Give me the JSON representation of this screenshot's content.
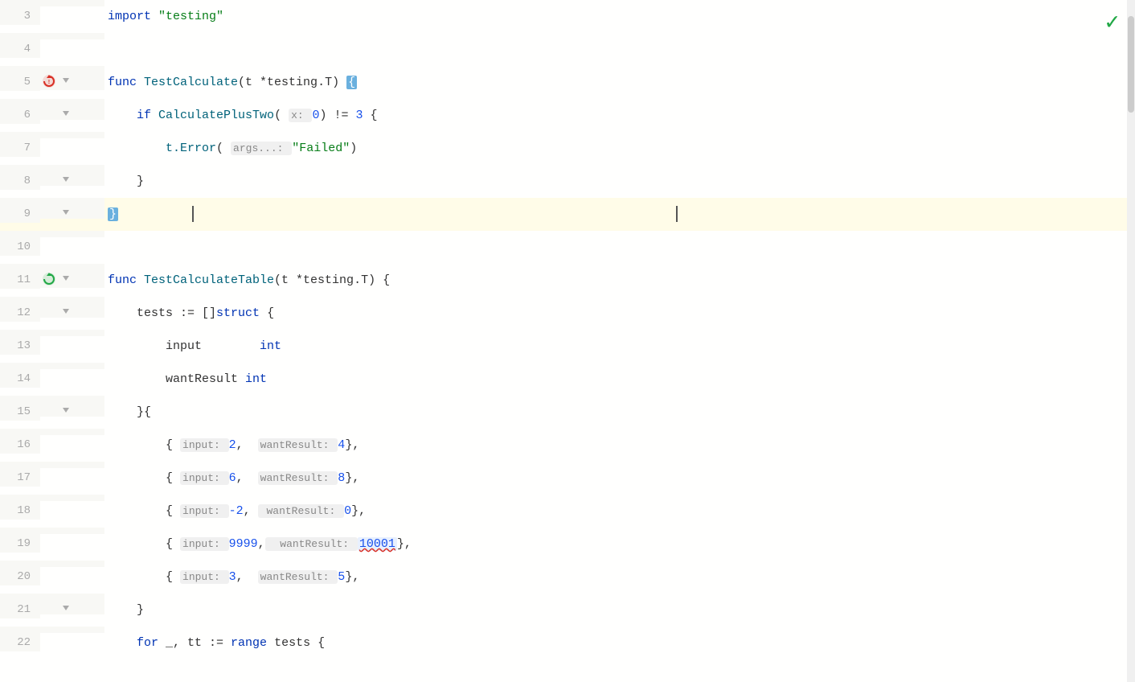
{
  "editor": {
    "background": "#fffffe",
    "checkmark": "✓",
    "lines": [
      {
        "number": "3",
        "indent": 0,
        "tokens": [
          {
            "text": "import ",
            "class": "kw"
          },
          {
            "text": "\"testing\"",
            "class": "str"
          }
        ],
        "fold": null,
        "run": null,
        "highlighted": false
      },
      {
        "number": "4",
        "indent": 0,
        "tokens": [],
        "fold": null,
        "run": null,
        "highlighted": false
      },
      {
        "number": "5",
        "indent": 0,
        "tokens": [
          {
            "text": "func ",
            "class": "kw"
          },
          {
            "text": "TestCalculate",
            "class": "fn"
          },
          {
            "text": "(t *testing.T) ",
            "class": "type"
          },
          {
            "text": "{",
            "class": "blue-bg-char"
          }
        ],
        "fold": "open",
        "run": "red",
        "highlighted": false
      },
      {
        "number": "6",
        "indent": 1,
        "tokens": [
          {
            "text": "if ",
            "class": "kw"
          },
          {
            "text": "CalculatePlusTwo",
            "class": "fn"
          },
          {
            "text": "( ",
            "class": "type"
          },
          {
            "text": "x: ",
            "class": "hint-label"
          },
          {
            "text": "0",
            "class": "num"
          },
          {
            "text": ") != ",
            "class": "type"
          },
          {
            "text": "3",
            "class": "num"
          },
          {
            "text": " {",
            "class": "type"
          }
        ],
        "fold": "open",
        "run": null,
        "highlighted": false
      },
      {
        "number": "7",
        "indent": 2,
        "tokens": [
          {
            "text": "t.Error",
            "class": "fn"
          },
          {
            "text": "( ",
            "class": "type"
          },
          {
            "text": "args...: ",
            "class": "hint-label"
          },
          {
            "text": "\"Failed\"",
            "class": "str"
          },
          {
            "text": ")",
            "class": "type"
          }
        ],
        "fold": null,
        "run": null,
        "highlighted": false
      },
      {
        "number": "8",
        "indent": 1,
        "tokens": [
          {
            "text": "}",
            "class": "type"
          }
        ],
        "fold": "close",
        "run": null,
        "highlighted": false
      },
      {
        "number": "9",
        "indent": 0,
        "tokens": [
          {
            "text": "}",
            "class": "blue-bg-char"
          },
          {
            "text": "          ",
            "class": "type"
          },
          {
            "text": "🖊",
            "class": "cursor-char"
          }
        ],
        "fold": "close",
        "run": null,
        "highlighted": true
      },
      {
        "number": "10",
        "indent": 0,
        "tokens": [],
        "fold": null,
        "run": null,
        "highlighted": false
      },
      {
        "number": "11",
        "indent": 0,
        "tokens": [
          {
            "text": "func ",
            "class": "kw"
          },
          {
            "text": "TestCalculateTable",
            "class": "fn"
          },
          {
            "text": "(t *testing.T) {",
            "class": "type"
          }
        ],
        "fold": "open",
        "run": "green",
        "highlighted": false
      },
      {
        "number": "12",
        "indent": 1,
        "tokens": [
          {
            "text": "tests := []",
            "class": "type"
          },
          {
            "text": "struct",
            "class": "kw"
          },
          {
            "text": " {",
            "class": "type"
          }
        ],
        "fold": "open",
        "run": null,
        "highlighted": false
      },
      {
        "number": "13",
        "indent": 2,
        "tokens": [
          {
            "text": "input",
            "class": "type"
          },
          {
            "text": "        ",
            "class": "type"
          },
          {
            "text": "int",
            "class": "kw"
          }
        ],
        "fold": null,
        "run": null,
        "highlighted": false
      },
      {
        "number": "14",
        "indent": 2,
        "tokens": [
          {
            "text": "wantResult ",
            "class": "type"
          },
          {
            "text": "int",
            "class": "kw"
          }
        ],
        "fold": null,
        "run": null,
        "highlighted": false
      },
      {
        "number": "15",
        "indent": 1,
        "tokens": [
          {
            "text": "}{",
            "class": "type"
          }
        ],
        "fold": "close",
        "run": null,
        "highlighted": false
      },
      {
        "number": "16",
        "indent": 2,
        "tokens": [
          {
            "text": "{ ",
            "class": "type"
          },
          {
            "text": "input: ",
            "class": "hint-label"
          },
          {
            "text": "2",
            "class": "num"
          },
          {
            "text": ",  ",
            "class": "type"
          },
          {
            "text": "wantResult: ",
            "class": "hint-label"
          },
          {
            "text": "4",
            "class": "num"
          },
          {
            "text": "},",
            "class": "type"
          }
        ],
        "fold": null,
        "run": null,
        "highlighted": false
      },
      {
        "number": "17",
        "indent": 2,
        "tokens": [
          {
            "text": "{ ",
            "class": "type"
          },
          {
            "text": "input: ",
            "class": "hint-label"
          },
          {
            "text": "6",
            "class": "num"
          },
          {
            "text": ",  ",
            "class": "type"
          },
          {
            "text": "wantResult: ",
            "class": "hint-label"
          },
          {
            "text": "8",
            "class": "num"
          },
          {
            "text": "},",
            "class": "type"
          }
        ],
        "fold": null,
        "run": null,
        "highlighted": false
      },
      {
        "number": "18",
        "indent": 2,
        "tokens": [
          {
            "text": "{ ",
            "class": "type"
          },
          {
            "text": "input: ",
            "class": "hint-label"
          },
          {
            "text": "-2",
            "class": "num"
          },
          {
            "text": ", ",
            "class": "type"
          },
          {
            "text": " wantResult: ",
            "class": "hint-label"
          },
          {
            "text": "0",
            "class": "num"
          },
          {
            "text": "},",
            "class": "type"
          }
        ],
        "fold": null,
        "run": null,
        "highlighted": false
      },
      {
        "number": "19",
        "indent": 2,
        "tokens": [
          {
            "text": "{ ",
            "class": "type"
          },
          {
            "text": "input: ",
            "class": "hint-label"
          },
          {
            "text": "9999",
            "class": "num"
          },
          {
            "text": ",",
            "class": "type"
          },
          {
            "text": "  wantResult: ",
            "class": "hint-label"
          },
          {
            "text": "10001",
            "class": "num-error"
          },
          {
            "text": "},",
            "class": "type"
          }
        ],
        "fold": null,
        "run": null,
        "highlighted": false
      },
      {
        "number": "20",
        "indent": 2,
        "tokens": [
          {
            "text": "{ ",
            "class": "type"
          },
          {
            "text": "input: ",
            "class": "hint-label"
          },
          {
            "text": "3",
            "class": "num"
          },
          {
            "text": ",  ",
            "class": "type"
          },
          {
            "text": "wantResult: ",
            "class": "hint-label"
          },
          {
            "text": "5",
            "class": "num"
          },
          {
            "text": "},",
            "class": "type"
          }
        ],
        "fold": null,
        "run": null,
        "highlighted": false
      },
      {
        "number": "21",
        "indent": 1,
        "tokens": [
          {
            "text": "}",
            "class": "type"
          }
        ],
        "fold": "close",
        "run": null,
        "highlighted": false
      },
      {
        "number": "22",
        "indent": 1,
        "tokens": [
          {
            "text": "for ",
            "class": "kw"
          },
          {
            "text": "_, tt := ",
            "class": "type"
          },
          {
            "text": "range ",
            "class": "kw"
          },
          {
            "text": "tests {",
            "class": "type"
          }
        ],
        "fold": null,
        "run": null,
        "highlighted": false
      }
    ]
  }
}
